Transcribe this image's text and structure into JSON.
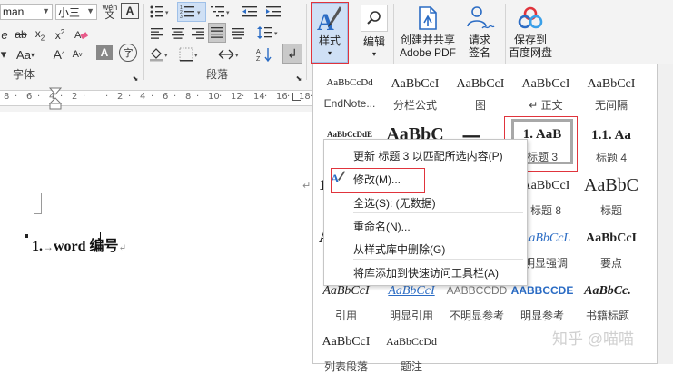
{
  "font": {
    "name_value": "man",
    "size_value": "小三",
    "group_label": "字体",
    "wen_icon": "wén",
    "aa_label": "Aa",
    "grow_label": "A",
    "shrink_label": "A",
    "a_box_label": "A",
    "clear_label": "A"
  },
  "paragraph": {
    "group_label": "段落"
  },
  "styles_button": {
    "label": "样式"
  },
  "edit_button": {
    "label": "编辑"
  },
  "adobe_button": {
    "line1": "创建并共享",
    "line2": "Adobe PDF"
  },
  "sign_button": {
    "line1": "请求",
    "line2": "签名"
  },
  "baidu_button": {
    "line1": "保存到",
    "line2": "百度网盘"
  },
  "ruler": {
    "ticks": [
      "8",
      "6",
      "4",
      "2",
      "",
      "2",
      "4",
      "6",
      "8",
      "10",
      "12",
      "14",
      "16",
      "18"
    ]
  },
  "document": {
    "heading_number": "1.",
    "heading_text": "word 编号"
  },
  "gallery": {
    "row1": [
      {
        "preview": "AaBbCcDd",
        "name": "EndNote..."
      },
      {
        "preview": "AaBbCcI",
        "name": "分栏公式"
      },
      {
        "preview": "AaBbCcI",
        "name": "图"
      },
      {
        "preview": "AaBbCcI",
        "name": "↵ 正文"
      },
      {
        "preview": "AaBbCcI",
        "name": "无间隔"
      }
    ],
    "row2": [
      {
        "preview": "AaBbCcDdE",
        "name": ""
      },
      {
        "preview": "AaBbC",
        "name": ""
      },
      {
        "preview": "一、",
        "name": ""
      },
      {
        "preview": "1.  AaB",
        "name": "标题 3"
      },
      {
        "preview": "1.1.  Aa",
        "name": "标题 4"
      }
    ],
    "row3_right": [
      {
        "preview": "AaBbCcI",
        "name": "标题 8"
      },
      {
        "preview": "AaBbC",
        "name": "标题"
      }
    ],
    "row4_right": [
      {
        "preview": "AaBbCcL",
        "name": "明显强调"
      },
      {
        "preview": "AaBbCcI",
        "name": "要点"
      }
    ],
    "row5": [
      {
        "preview": "AaBbCcI",
        "name": "引用"
      },
      {
        "preview": "AaBbCcI",
        "name": "明显引用"
      },
      {
        "preview": "AABBCCDD",
        "name": "不明显参考"
      },
      {
        "preview": "AABBCCDE",
        "name": "明显参考"
      },
      {
        "preview": "AaBbCc.",
        "name": "书籍标题"
      }
    ],
    "row6": [
      {
        "preview": "AaBbCcI",
        "name": "列表段落"
      },
      {
        "preview": "AaBbCcDd",
        "name": "题注"
      }
    ],
    "left_fragments": {
      "r3": "1",
      "r4": "A"
    }
  },
  "context_menu": {
    "update": "更新 标题 3 以匹配所选内容(P)",
    "modify": "修改(M)...",
    "select_all": "全选(S): (无数据)",
    "rename": "重命名(N)...",
    "remove": "从样式库中删除(G)",
    "add_qat": "将库添加到快速访问工具栏(A)"
  },
  "watermark": "知乎 @喵喵",
  "colors": {
    "accent_blue": "#2b6cc4",
    "highlight_red": "#e0343c",
    "ribbon_bg": "#f3f3f3",
    "selected_button_bg": "#cfe0f5"
  }
}
